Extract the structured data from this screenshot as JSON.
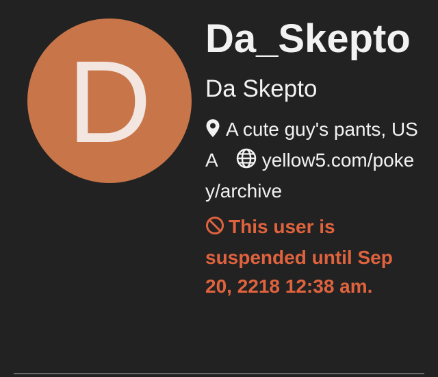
{
  "profile": {
    "avatar_letter": "D",
    "avatar_color": "#c8754a",
    "username": "Da_Skepto",
    "display_name": "Da Skepto",
    "location": "A cute guy's pants, USA",
    "website": "yellow5.com/pokey/archive",
    "suspension_notice": "This user is suspended until Sep 20, 2218 12:38 am.",
    "suspension_color": "#e0633e"
  },
  "icons": {
    "location": "map-pin-icon",
    "website": "globe-icon",
    "suspension": "ban-icon"
  }
}
